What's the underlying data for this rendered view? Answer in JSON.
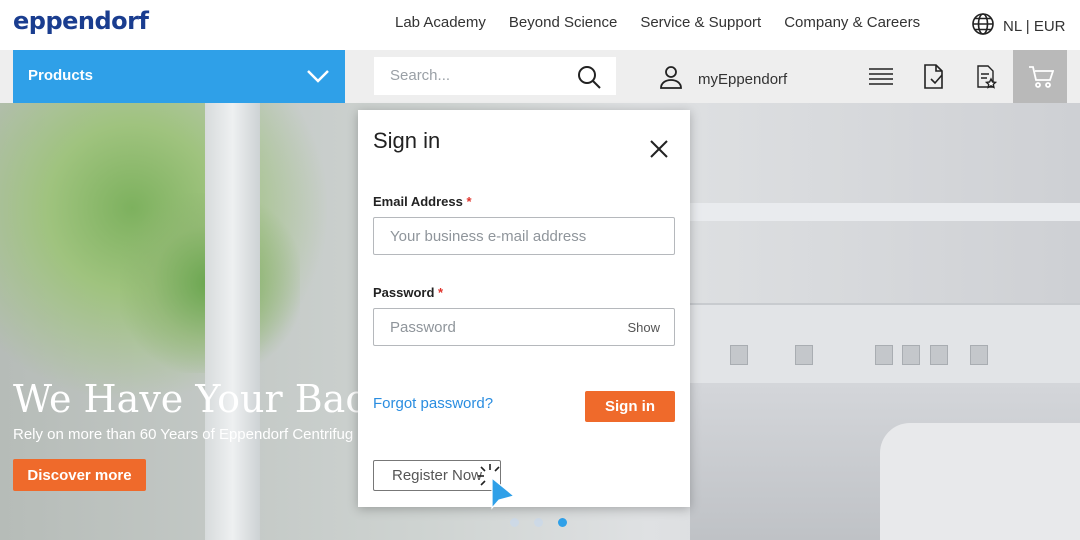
{
  "header": {
    "logo": "eppendorf",
    "nav": [
      "Lab Academy",
      "Beyond Science",
      "Service & Support",
      "Company & Careers"
    ],
    "locale": "NL | EUR"
  },
  "toolbar": {
    "products_label": "Products",
    "search_placeholder": "Search...",
    "account_label": "myEppendorf"
  },
  "hero": {
    "title": "We Have Your Back",
    "subtitle": "Rely on more than 60 Years of Eppendorf Centrifug",
    "cta": "Discover more"
  },
  "signin_modal": {
    "title": "Sign in",
    "email_label": "Email Address",
    "email_placeholder": "Your business e-mail address",
    "password_label": "Password",
    "password_placeholder": "Password",
    "show_label": "Show",
    "required_mark": "*",
    "forgot_label": "Forgot password?",
    "signin_button": "Sign in",
    "register_button": "Register Now"
  },
  "colors": {
    "brand_blue": "#1a3d8f",
    "accent_blue": "#2fa0e8",
    "orange": "#ef6a2b"
  }
}
